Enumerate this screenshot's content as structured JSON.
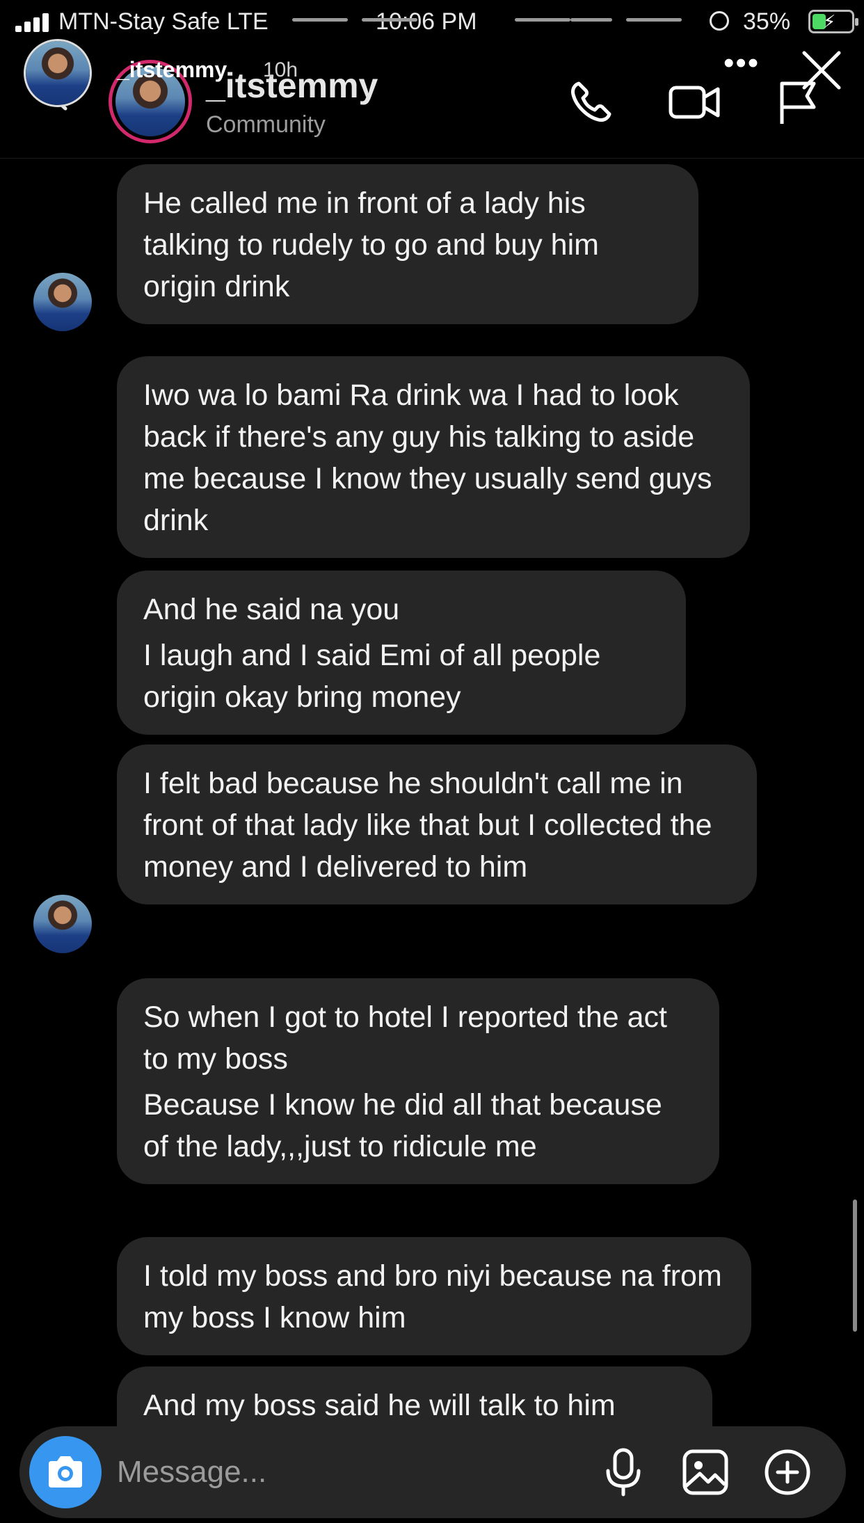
{
  "status_bar": {
    "carrier": "MTN-Stay Safe  LTE",
    "time": "10:06 PM",
    "battery_pct": "35%",
    "battery_level": 0.35,
    "battery_color": "#4cd964"
  },
  "story": {
    "username": "_itstemmy",
    "age": "10h",
    "more_icon": "more-horizontal-icon",
    "close_icon": "close-icon"
  },
  "header": {
    "name": "_itstemmy",
    "subtitle": "Community",
    "ring_color": "#d1296b",
    "icons": [
      "back-arrow-icon",
      "phone-icon",
      "video-camera-icon",
      "flag-icon"
    ]
  },
  "messages": [
    {
      "lines": [
        "He called me in front of a lady his talking to rudely to go and buy him origin drink"
      ],
      "show_avatar": true
    },
    {
      "lines": [
        "Iwo wa lo bami Ra drink wa I had to look back if there's any guy his talking to aside me because I know they usually send guys drink"
      ],
      "show_avatar": false
    },
    {
      "lines": [
        "And he said na you",
        "I laugh and I said Emi of all people origin okay bring money"
      ],
      "show_avatar": false
    },
    {
      "lines": [
        "I felt bad because he shouldn't call me in front of that lady like that but I collected the money and I delivered to him"
      ],
      "show_avatar": true
    },
    {
      "lines": [
        "So when I got to hotel I reported the act to my boss",
        "Because I know he did all that because of the lady,,,just to ridicule me"
      ],
      "show_avatar": false
    },
    {
      "lines": [
        "I told my boss and bro niyi because na from my boss I know him"
      ],
      "show_avatar": false
    },
    {
      "lines": [
        "And my boss said he will talk to him"
      ],
      "show_avatar": false
    }
  ],
  "composer": {
    "placeholder": "Message...",
    "accent": "#3797f0",
    "icons": [
      "camera-icon",
      "microphone-icon",
      "image-icon",
      "add-circle-icon"
    ]
  }
}
